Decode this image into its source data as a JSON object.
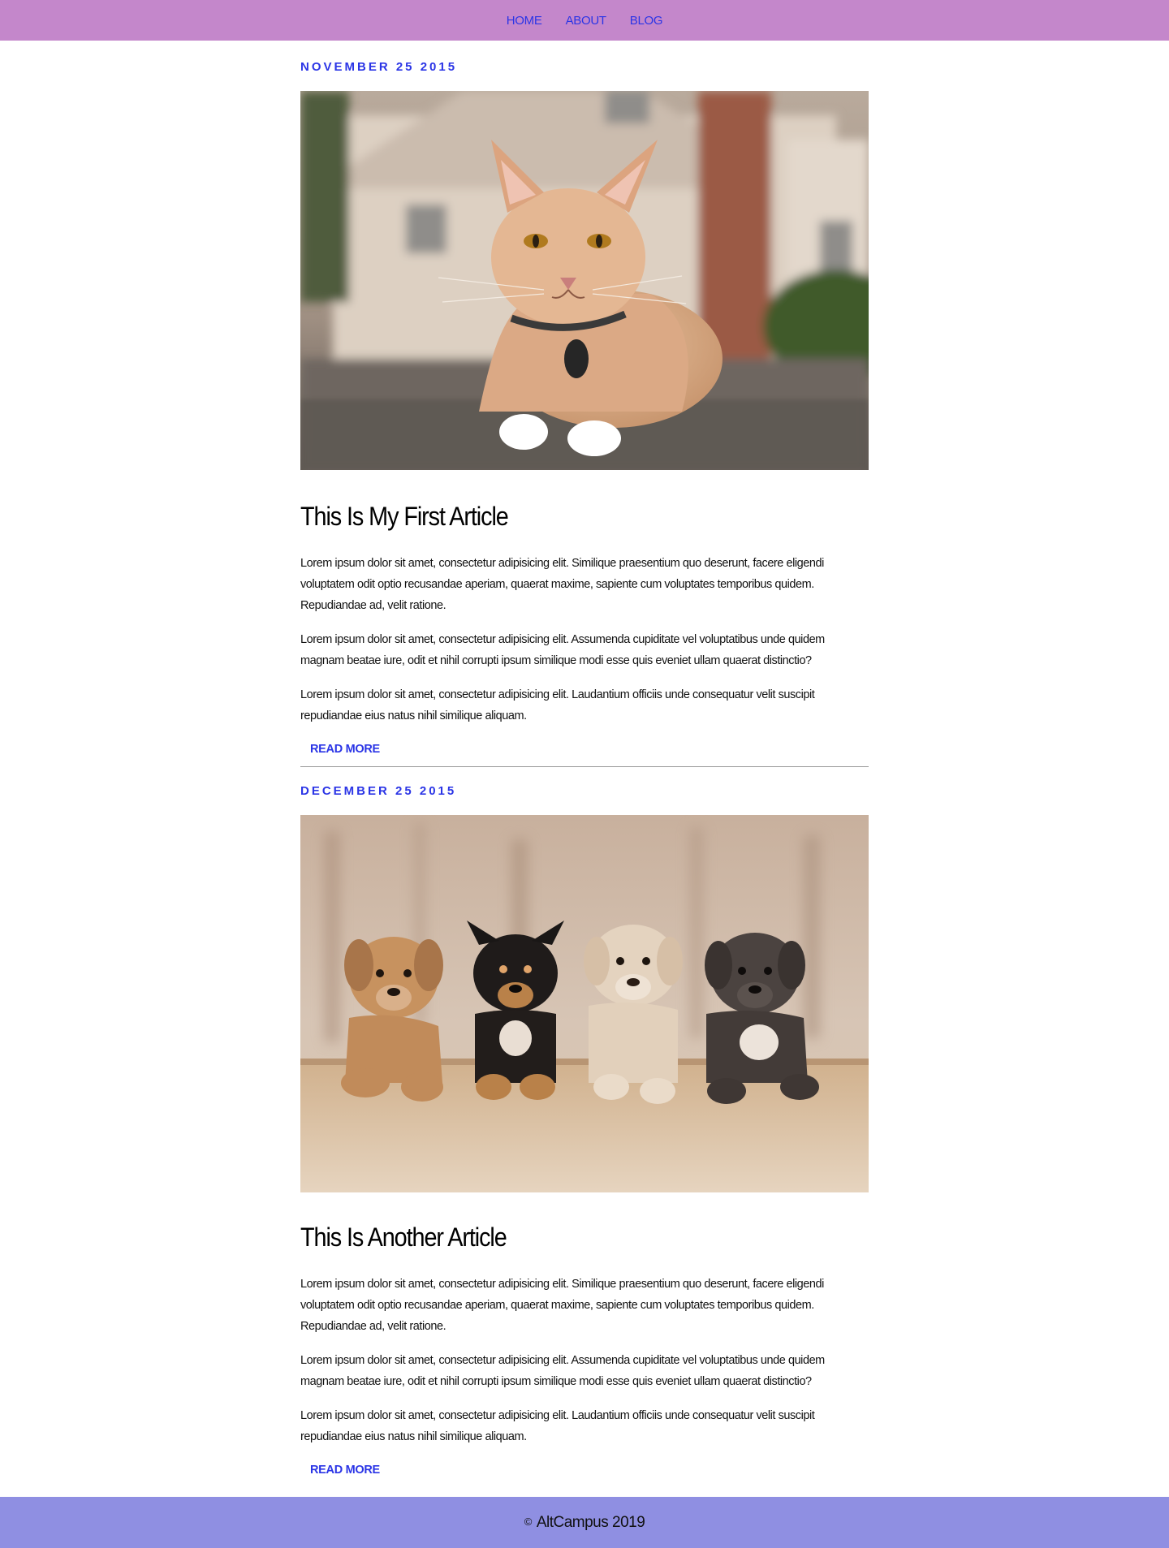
{
  "nav": {
    "items": [
      {
        "label": "HOME"
      },
      {
        "label": "ABOUT"
      },
      {
        "label": "BLOG"
      }
    ]
  },
  "colors": {
    "navbar_bg": "#c487cb",
    "footer_bg": "#8f8fe2",
    "link": "#2b35e6"
  },
  "articles": [
    {
      "date": "NOVEMBER 25 2015",
      "image_subject": "cat-photo",
      "title": "This Is My First Article",
      "paragraphs": [
        "Lorem ipsum dolor sit amet, consectetur adipisicing elit. Similique praesentium quo deserunt, facere eligendi voluptatem odit optio recusandae aperiam, quaerat maxime, sapiente cum voluptates temporibus quidem. Repudiandae ad, velit ratione.",
        "Lorem ipsum dolor sit amet, consectetur adipisicing elit. Assumenda cupiditate vel voluptatibus unde quidem magnam beatae iure, odit et nihil corrupti ipsum similique modi esse quis eveniet ullam quaerat distinctio?",
        "Lorem ipsum dolor sit amet, consectetur adipisicing elit. Laudantium officiis unde consequatur velit suscipit repudiandae eius natus nihil similique aliquam."
      ],
      "read_more": "READ MORE"
    },
    {
      "date": "DECEMBER 25 2015",
      "image_subject": "puppies-photo",
      "title": "This Is Another Article",
      "paragraphs": [
        "Lorem ipsum dolor sit amet, consectetur adipisicing elit. Similique praesentium quo deserunt, facere eligendi voluptatem odit optio recusandae aperiam, quaerat maxime, sapiente cum voluptates temporibus quidem. Repudiandae ad, velit ratione.",
        "Lorem ipsum dolor sit amet, consectetur adipisicing elit. Assumenda cupiditate vel voluptatibus unde quidem magnam beatae iure, odit et nihil corrupti ipsum similique modi esse quis eveniet ullam quaerat distinctio?",
        "Lorem ipsum dolor sit amet, consectetur adipisicing elit. Laudantium officiis unde consequatur velit suscipit repudiandae eius natus nihil similique aliquam."
      ],
      "read_more": "READ MORE"
    }
  ],
  "footer": {
    "copyright_symbol": "©",
    "text": "AltCampus 2019"
  }
}
